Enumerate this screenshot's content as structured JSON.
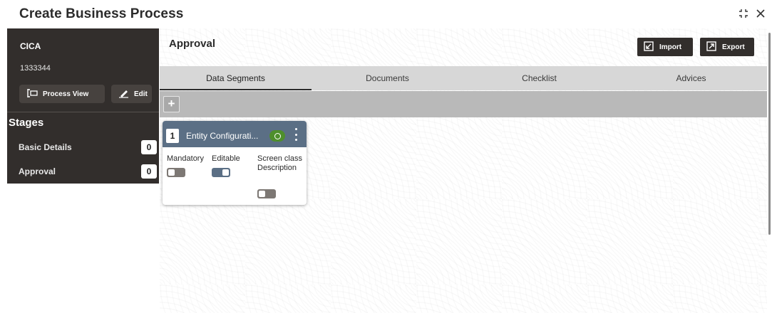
{
  "window": {
    "title": "Create Business Process"
  },
  "sidebar": {
    "name": "CICA",
    "code": "1333344",
    "process_view_label": "Process View",
    "edit_label": "Edit",
    "stages_heading": "Stages",
    "stages": [
      {
        "label": "Basic Details",
        "count": "0"
      },
      {
        "label": "Approval",
        "count": "0"
      }
    ]
  },
  "main": {
    "heading": "Approval",
    "import_label": "Import",
    "export_label": "Export",
    "tabs": [
      {
        "label": "Data Segments",
        "active": true
      },
      {
        "label": "Documents",
        "active": false
      },
      {
        "label": "Checklist",
        "active": false
      },
      {
        "label": "Advices",
        "active": false
      }
    ],
    "add_label": "+",
    "card": {
      "number": "1",
      "title": "Entity Configurati...",
      "fields": {
        "mandatory": {
          "label": "Mandatory",
          "on": false
        },
        "editable": {
          "label": "Editable",
          "on": true
        },
        "screen_desc": {
          "label": "Screen class Description",
          "on": false
        }
      }
    }
  },
  "colors": {
    "sidebar_bg": "#322e2c",
    "card_header": "#5b6f85",
    "status_green": "#4e8f2c"
  }
}
